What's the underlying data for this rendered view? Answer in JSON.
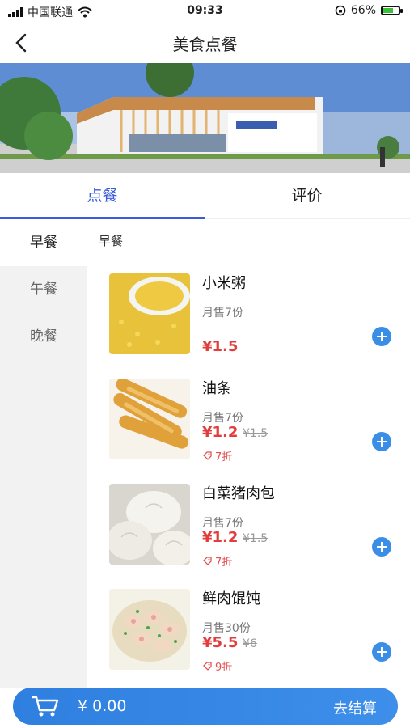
{
  "status_bar": {
    "carrier": "中国联通",
    "time": "09:33",
    "battery": "66%"
  },
  "nav": {
    "title": "美食点餐"
  },
  "tabs": [
    {
      "label": "点餐"
    },
    {
      "label": "评价"
    }
  ],
  "sidebar": {
    "items": [
      {
        "label": "早餐"
      },
      {
        "label": "午餐"
      },
      {
        "label": "晚餐"
      }
    ]
  },
  "section_title": "早餐",
  "foods": [
    {
      "name": "小米粥",
      "sold": "月售7份",
      "price": "¥1.5"
    },
    {
      "name": "油条",
      "sold": "月售7份",
      "price": "¥1.2",
      "original": "¥1.5",
      "discount": "7折"
    },
    {
      "name": "白菜猪肉包",
      "sold": "月售7份",
      "price": "¥1.2",
      "original": "¥1.5",
      "discount": "7折"
    },
    {
      "name": "鲜肉馄饨",
      "sold": "月售30份",
      "price": "¥5.5",
      "original": "¥6",
      "discount": "9折"
    }
  ],
  "cart": {
    "amount": "¥ 0.00",
    "checkout": "去结算"
  },
  "colors": {
    "accent": "#3b5bdb",
    "price": "#e23d3d",
    "cart": "#3d8fea"
  }
}
